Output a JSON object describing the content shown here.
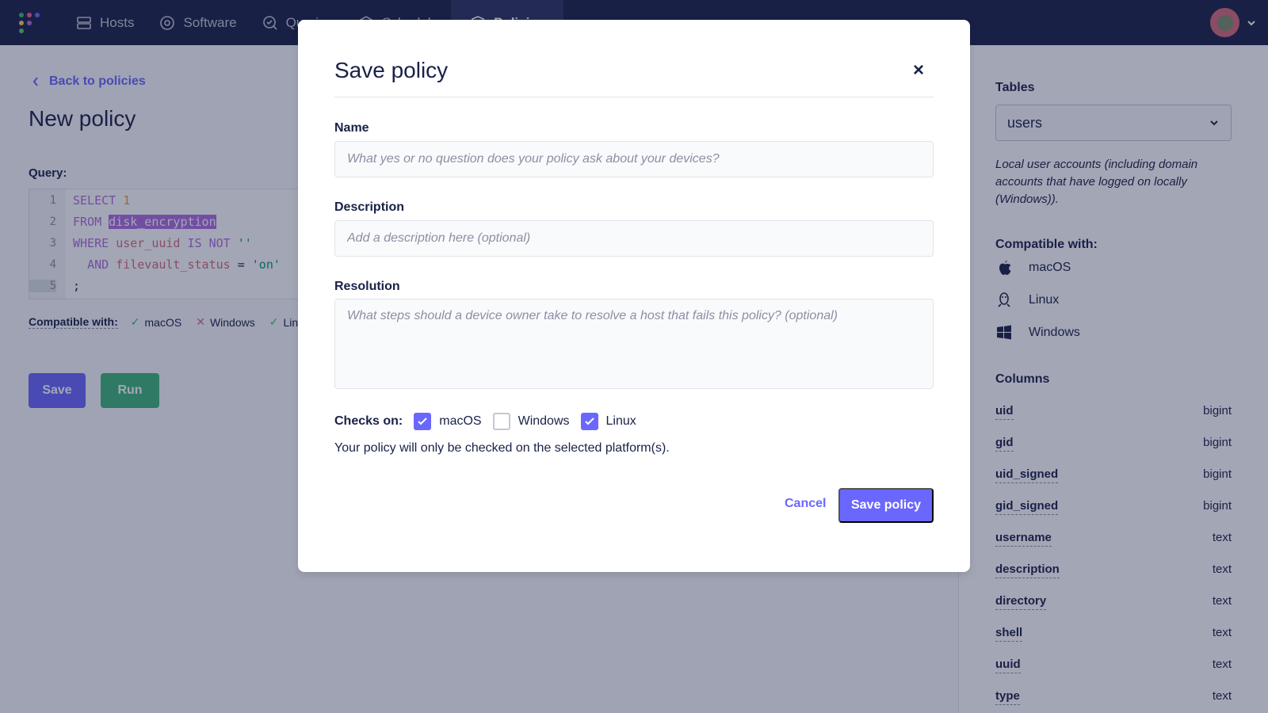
{
  "nav": {
    "items": [
      {
        "label": "Hosts",
        "icon": "hosts-icon"
      },
      {
        "label": "Software",
        "icon": "software-icon"
      },
      {
        "label": "Queries",
        "icon": "queries-icon"
      },
      {
        "label": "Schedule",
        "icon": "schedule-icon"
      },
      {
        "label": "Policies",
        "icon": "policies-icon"
      }
    ],
    "active": "Policies"
  },
  "page": {
    "back_link": "Back to policies",
    "title": "New policy",
    "query_label": "Query:",
    "code_lines": [
      {
        "num": "1"
      },
      {
        "num": "2"
      },
      {
        "num": "3"
      },
      {
        "num": "4"
      },
      {
        "num": "5"
      }
    ],
    "code": {
      "select": "SELECT",
      "one": "1",
      "from": "FROM",
      "table": "disk_encryption",
      "where": "WHERE",
      "col1": "user_uuid",
      "is_not": "IS NOT",
      "empty_str": "''",
      "and": "AND",
      "col2": "filevault_status",
      "eq": "=",
      "on_str": "'on'",
      "semicolon": ";"
    },
    "compatible_label": "Compatible with:",
    "compatible": [
      {
        "name": "macOS",
        "status": "ok"
      },
      {
        "name": "Windows",
        "status": "no"
      },
      {
        "name": "Lin",
        "status": "ok"
      }
    ],
    "save_label": "Save",
    "run_label": "Run"
  },
  "sidebar": {
    "tables_heading": "Tables",
    "selected_table": "users",
    "table_description": "Local user accounts (including domain accounts that have logged on locally (Windows)).",
    "compatible_heading": "Compatible with:",
    "platforms": [
      {
        "name": "macOS",
        "icon": "apple-icon"
      },
      {
        "name": "Linux",
        "icon": "linux-icon"
      },
      {
        "name": "Windows",
        "icon": "windows-icon"
      }
    ],
    "columns_heading": "Columns",
    "columns": [
      {
        "name": "uid",
        "type": "bigint"
      },
      {
        "name": "gid",
        "type": "bigint"
      },
      {
        "name": "uid_signed",
        "type": "bigint"
      },
      {
        "name": "gid_signed",
        "type": "bigint"
      },
      {
        "name": "username",
        "type": "text"
      },
      {
        "name": "description",
        "type": "text"
      },
      {
        "name": "directory",
        "type": "text"
      },
      {
        "name": "shell",
        "type": "text"
      },
      {
        "name": "uuid",
        "type": "text"
      },
      {
        "name": "type",
        "type": "text"
      }
    ]
  },
  "modal": {
    "title": "Save policy",
    "close_glyph": "×",
    "name_label": "Name",
    "name_placeholder": "What yes or no question does your policy ask about your devices?",
    "description_label": "Description",
    "description_placeholder": "Add a description here (optional)",
    "resolution_label": "Resolution",
    "resolution_placeholder": "What steps should a device owner take to resolve a host that fails this policy? (optional)",
    "checks_label": "Checks on:",
    "checks": [
      {
        "name": "macOS",
        "checked": true
      },
      {
        "name": "Windows",
        "checked": false
      },
      {
        "name": "Linux",
        "checked": true
      }
    ],
    "checks_help": "Your policy will only be checked on the selected platform(s).",
    "cancel_label": "Cancel",
    "save_label": "Save policy"
  },
  "colors": {
    "nav_bg": "#192147",
    "accent": "#6a67fe",
    "run_green": "#3db67b",
    "overlay": "rgba(25,33,71,0.4)"
  }
}
